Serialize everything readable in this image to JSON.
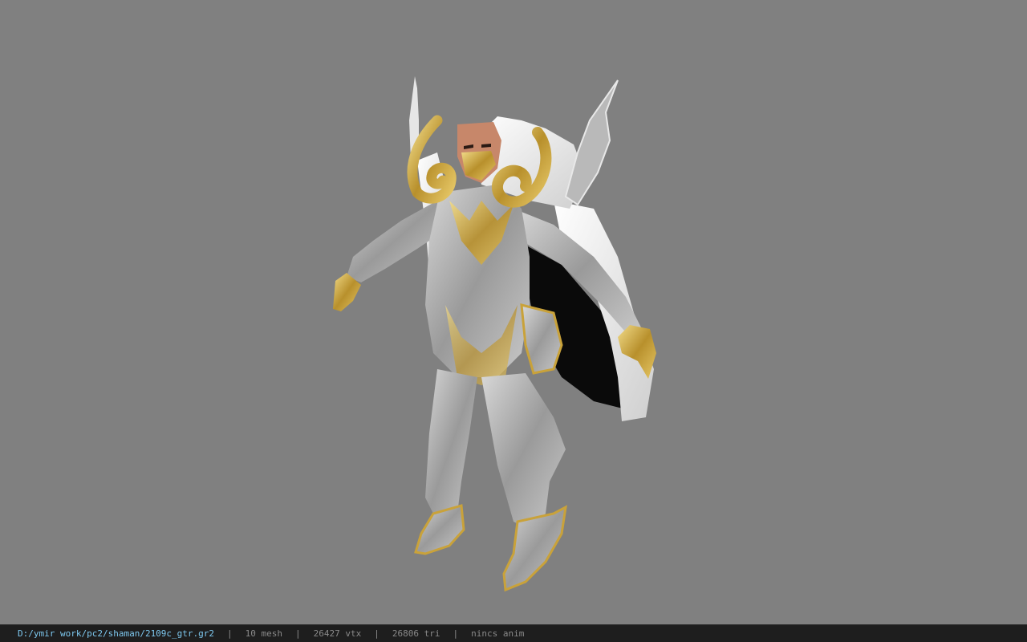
{
  "viewport": {
    "background": "#808080",
    "model_icon": "armored-character-model"
  },
  "status": {
    "file_path": "D:/ymir work/pc2/shaman/2109c_gtr.gr2",
    "mesh_count": "10 mesh",
    "vertex_count": "26427 vtx",
    "triangle_count": "26806 tri",
    "anim": "nincs anim",
    "separator": "|",
    "path_color": "#7ec9f0"
  }
}
